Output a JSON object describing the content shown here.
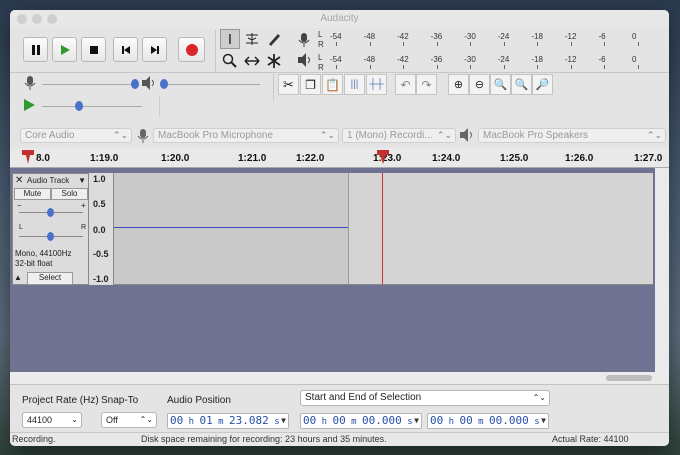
{
  "window": {
    "title": "Audacity"
  },
  "meters": {
    "record_scale": [
      "-54",
      "-48",
      "-42",
      "-36",
      "-30",
      "-24",
      "-18",
      "-12",
      "-6",
      "0"
    ],
    "play_scale": [
      "-54",
      "-48",
      "-42",
      "-36",
      "-30",
      "-24",
      "-18",
      "-12",
      "-6",
      "0"
    ],
    "channel_l": "L",
    "channel_r": "R"
  },
  "devices": {
    "host": "Core Audio",
    "recording_device": "MacBook Pro Microphone",
    "channels": "1 (Mono) Recordi...",
    "playback_device": "MacBook Pro Speakers"
  },
  "ruler": {
    "ticks": [
      "8.0",
      "1:19.0",
      "1:20.0",
      "1:21.0",
      "1:22.0",
      "1:23.0",
      "1:24.0",
      "1:25.0",
      "1:26.0",
      "1:27.0"
    ]
  },
  "track": {
    "name": "Audio Track",
    "mute": "Mute",
    "solo": "Solo",
    "gain_minus": "−",
    "gain_plus": "+",
    "pan_left": "L",
    "pan_right": "R",
    "format": "Mono, 44100Hz",
    "bits": "32-bit float",
    "select": "Select",
    "scale": [
      "1.0",
      "0.5",
      "0.0",
      "-0.5",
      "-1.0"
    ]
  },
  "bottom": {
    "project_rate_label": "Project Rate (Hz)",
    "project_rate": "44100",
    "snap_label": "Snap-To",
    "snap_value": "Off",
    "audio_position_label": "Audio Position",
    "audio_position": {
      "h": "00",
      "m": "01",
      "s": "23.082"
    },
    "selection_mode": "Start and End of Selection",
    "sel_start": {
      "h": "00",
      "m": "00",
      "s": "00.000"
    },
    "sel_end": {
      "h": "00",
      "m": "00",
      "s": "00.000"
    }
  },
  "status": {
    "state": "Recording.",
    "disk": "Disk space remaining for recording: 23 hours and 35 minutes.",
    "rate": "Actual Rate: 44100"
  }
}
